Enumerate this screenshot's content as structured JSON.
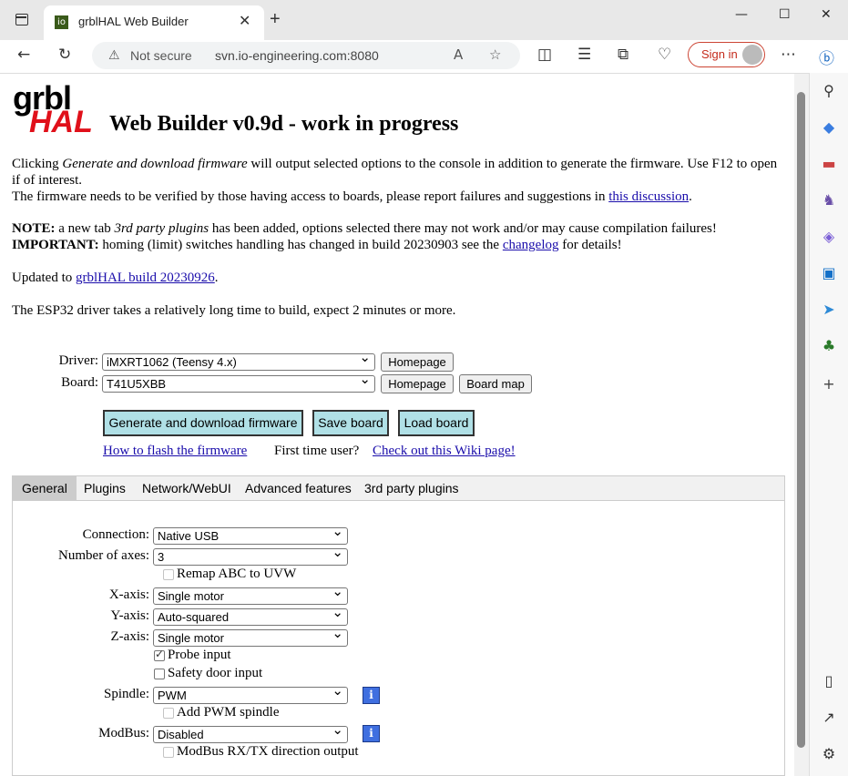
{
  "browser": {
    "tab_title": "grblHAL Web Builder",
    "favicon_text": "io",
    "security_label": "Not secure",
    "url": "svn.io-engineering.com:8080",
    "signin_label": "Sign in"
  },
  "logo": {
    "top": "grbl",
    "bottom": "HAL"
  },
  "heading": "Web Builder v0.9d - work in progress",
  "intro": {
    "line1_a": "Clicking ",
    "line1_em": "Generate and download firmware",
    "line1_b": " will output selected options to the console in addition to generate the firmware. Use F12 to open if of interest.",
    "line2_a": "The firmware needs to be verified by those having access to boards, please report failures and suggestions in ",
    "line2_link": "this discussion",
    "line2_b": ".",
    "note_label": "NOTE:",
    "note_a": " a new tab ",
    "note_em": "3rd party plugins",
    "note_b": " has been added, options selected there may not work and/or may cause compilation failures!",
    "important_label": "IMPORTANT:",
    "important_a": " homing (limit) switches handling has changed in build 20230903 see the ",
    "important_link": "changelog",
    "important_b": " for details!",
    "updated_a": "Updated to ",
    "updated_link": "grblHAL build 20230926",
    "updated_b": ".",
    "esp32": "The ESP32 driver takes a relatively long time to build, expect 2 minutes or more."
  },
  "driver": {
    "label": "Driver:",
    "value": "iMXRT1062 (Teensy 4.x)",
    "homepage": "Homepage"
  },
  "board": {
    "label": "Board:",
    "value": "T41U5XBB",
    "homepage": "Homepage",
    "board_map": "Board map"
  },
  "actions": {
    "generate": "Generate and download firmware",
    "save": "Save board",
    "load": "Load board",
    "flash_link": "How to flash the firmware",
    "first_time": "First time user?",
    "wiki_link": "Check out this Wiki page!"
  },
  "tabs": [
    "General",
    "Plugins",
    "Network/WebUI",
    "Advanced features",
    "3rd party plugins"
  ],
  "general": {
    "connection": {
      "label": "Connection:",
      "value": "Native USB"
    },
    "axes": {
      "label": "Number of axes:",
      "value": "3"
    },
    "remap": {
      "label": "Remap ABC to UVW",
      "checked": false,
      "disabled": true
    },
    "x_axis": {
      "label": "X-axis:",
      "value": "Single motor"
    },
    "y_axis": {
      "label": "Y-axis:",
      "value": "Auto-squared"
    },
    "z_axis": {
      "label": "Z-axis:",
      "value": "Single motor"
    },
    "probe": {
      "label": "Probe input",
      "checked": true
    },
    "safety_door": {
      "label": "Safety door input",
      "checked": false
    },
    "spindle": {
      "label": "Spindle:",
      "value": "PWM",
      "info": "i"
    },
    "add_pwm": {
      "label": "Add PWM spindle",
      "checked": false,
      "disabled": true
    },
    "modbus": {
      "label": "ModBus:",
      "value": "Disabled",
      "info": "i"
    },
    "modbus_rxtx": {
      "label": "ModBus RX/TX direction output",
      "checked": false,
      "disabled": true
    }
  },
  "colors": {
    "accent_button": "#b0e0e6",
    "logo_red": "#e0101a",
    "info_blue": "#3f6fe0",
    "link": "#1a0dab"
  }
}
